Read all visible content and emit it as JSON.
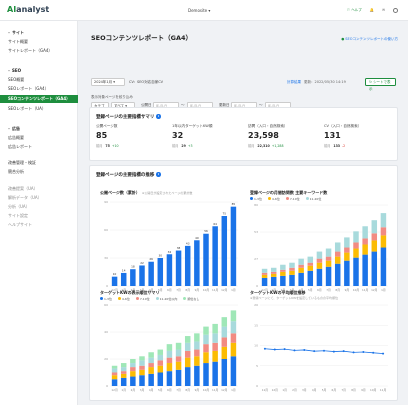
{
  "header": {
    "logo_ai": "AI",
    "logo_rest": "analyst",
    "site": "Demosite",
    "help": "ヘルプ",
    "chevron": "▾"
  },
  "sidebar": {
    "sections": [
      {
        "label": "サイト",
        "items": [
          {
            "label": "サイト概要"
          },
          {
            "label": "サイトレポート（GA4）"
          }
        ]
      },
      {
        "label": "SEO",
        "items": [
          {
            "label": "SEO概要"
          },
          {
            "label": "SEOレポート（GA4）"
          },
          {
            "label": "SEOコンテンツレポート（GA4）",
            "active": true
          },
          {
            "label": "SEOレポート（UA）"
          }
        ]
      },
      {
        "label": "広告",
        "items": [
          {
            "label": "広告概要"
          },
          {
            "label": "広告レポート"
          }
        ]
      }
    ],
    "extra": [
      {
        "label": "改善管理・検証"
      },
      {
        "label": "競合分析"
      }
    ],
    "dim": [
      {
        "label": "改善提案（UA）"
      },
      {
        "label": "解析データ（UA）"
      },
      {
        "label": "分析（UA）"
      },
      {
        "label": "サイト設定"
      },
      {
        "label": "ヘルプサイト"
      }
    ]
  },
  "page": {
    "title": "SEOコンテンツレポート（GA4）",
    "guide": "SEOコンテンツレポートの使い方"
  },
  "filters": {
    "period": "2024年1月",
    "cv_label": "CV：",
    "cv_value": "SEO対応自家CV",
    "calc_label": "計算結果",
    "updated": "更新：2022/05/30 14:19",
    "sheet_btn": "シートで表示",
    "narrow_title": "表示対象ページを絞り込み",
    "category": "カテゴリ",
    "all": "すべて",
    "public_date": "公開日",
    "update_date": "更新日",
    "from": "年-月-日",
    "to": "年-月-日",
    "tilde": "〜"
  },
  "summary": {
    "title": "登録ページの主要指標サマリ",
    "prev_label": "前月",
    "metrics": [
      {
        "label": "公開ページ数",
        "value": "85",
        "prev": "75",
        "diff": "+10",
        "dir": "up"
      },
      {
        "label": "1年以内ターゲットKW順",
        "value": "32",
        "prev": "29",
        "diff": "+3",
        "dir": "up"
      },
      {
        "label": "訪問（入口・自然検索）",
        "value": "23,598",
        "prev": "22,310",
        "diff": "+1,288",
        "dir": "up"
      },
      {
        "label": "CV（入口・自然検索）",
        "value": "131",
        "prev": "133",
        "diff": "-2",
        "dir": "down"
      }
    ]
  },
  "trend": {
    "title": "登録ページの主要指標の推移"
  },
  "chart_data": [
    {
      "type": "bar",
      "title": "公開ページ数（累計）",
      "subtitle": "※公開日が設定されたページの累計数",
      "categories": [
        "12月",
        "1月",
        "2月",
        "3月",
        "4月",
        "5月",
        "6月",
        "7月",
        "8月",
        "9月",
        "10月",
        "11月",
        "12月",
        "1月"
      ],
      "values": [
        10,
        14,
        18,
        22,
        26,
        30,
        34,
        38,
        43,
        49,
        56,
        64,
        75,
        85
      ],
      "ylim": [
        0,
        90
      ],
      "color": "#1a73e8"
    },
    {
      "type": "bar",
      "title": "登録ページの月間訪問数 主要キーワード数",
      "legend": [
        "1-3位",
        "4-6位",
        "7-10位",
        "11-20位"
      ],
      "colors": [
        "#1a73e8",
        "#fbbc04",
        "#f28b82",
        "#a8dadc"
      ],
      "categories": [
        "12月",
        "1月",
        "2月",
        "3月",
        "4月",
        "5月",
        "6月",
        "7月",
        "8月",
        "9月",
        "10月",
        "11月",
        "12月",
        "1月"
      ],
      "series": [
        {
          "name": "1-3位",
          "values": [
            8,
            9,
            10,
            11,
            13,
            15,
            17,
            19,
            22,
            25,
            28,
            31,
            34,
            38
          ]
        },
        {
          "name": "4-6位",
          "values": [
            3,
            3,
            4,
            4,
            5,
            5,
            6,
            6,
            7,
            8,
            9,
            10,
            11,
            12
          ]
        },
        {
          "name": "7-10位",
          "values": [
            2,
            2,
            2,
            3,
            3,
            3,
            4,
            4,
            5,
            5,
            6,
            6,
            7,
            8
          ]
        },
        {
          "name": "11-20位",
          "values": [
            4,
            4,
            5,
            5,
            6,
            6,
            7,
            8,
            9,
            10,
            11,
            12,
            13,
            14
          ]
        }
      ],
      "ylim": [
        0,
        80
      ]
    },
    {
      "type": "bar",
      "title": "ターゲットKWの表示順位サマリ",
      "legend": [
        "1-3位",
        "4-6位",
        "7-10位",
        "11-20位以内",
        "順位なし"
      ],
      "colors": [
        "#1a73e8",
        "#fbbc04",
        "#f28b82",
        "#a8dadc",
        "#9fe7b7"
      ],
      "categories": [
        "12月",
        "1月",
        "2月",
        "3月",
        "4月",
        "5月",
        "6月",
        "7月",
        "8月",
        "9月",
        "10月",
        "11月",
        "12月",
        "1月"
      ],
      "series": [
        {
          "name": "1-3位",
          "values": [
            5,
            6,
            7,
            8,
            9,
            10,
            11,
            12,
            14,
            15,
            17,
            18,
            20,
            22
          ]
        },
        {
          "name": "4-6位",
          "values": [
            3,
            3,
            4,
            4,
            5,
            5,
            6,
            6,
            7,
            7,
            8,
            8,
            9,
            10
          ]
        },
        {
          "name": "7-10位",
          "values": [
            2,
            2,
            3,
            3,
            3,
            4,
            4,
            4,
            5,
            5,
            6,
            6,
            7,
            7
          ]
        },
        {
          "name": "11-20位以内",
          "values": [
            3,
            3,
            3,
            4,
            4,
            4,
            5,
            5,
            6,
            6,
            7,
            7,
            8,
            9
          ]
        },
        {
          "name": "順位なし",
          "values": [
            2,
            3,
            3,
            3,
            4,
            4,
            5,
            5,
            5,
            6,
            6,
            7,
            7,
            8
          ]
        }
      ],
      "ylim": [
        0,
        60
      ]
    },
    {
      "type": "line",
      "title": "ターゲットKWの平均順位推移",
      "subtitle": "※登録ページにて、ターゲットKWを設定しているものの平均順位",
      "categories": [
        "11月",
        "12月",
        "1月",
        "2月",
        "3月",
        "4月",
        "5月",
        "6月",
        "7月",
        "8月",
        "9月",
        "10月",
        "11月"
      ],
      "values": [
        9.2,
        9.0,
        9.1,
        8.8,
        8.9,
        8.6,
        8.7,
        8.5,
        8.6,
        8.3,
        8.4,
        8.2,
        8.0
      ],
      "ylim": [
        0,
        20
      ],
      "color": "#1a73e8"
    }
  ]
}
